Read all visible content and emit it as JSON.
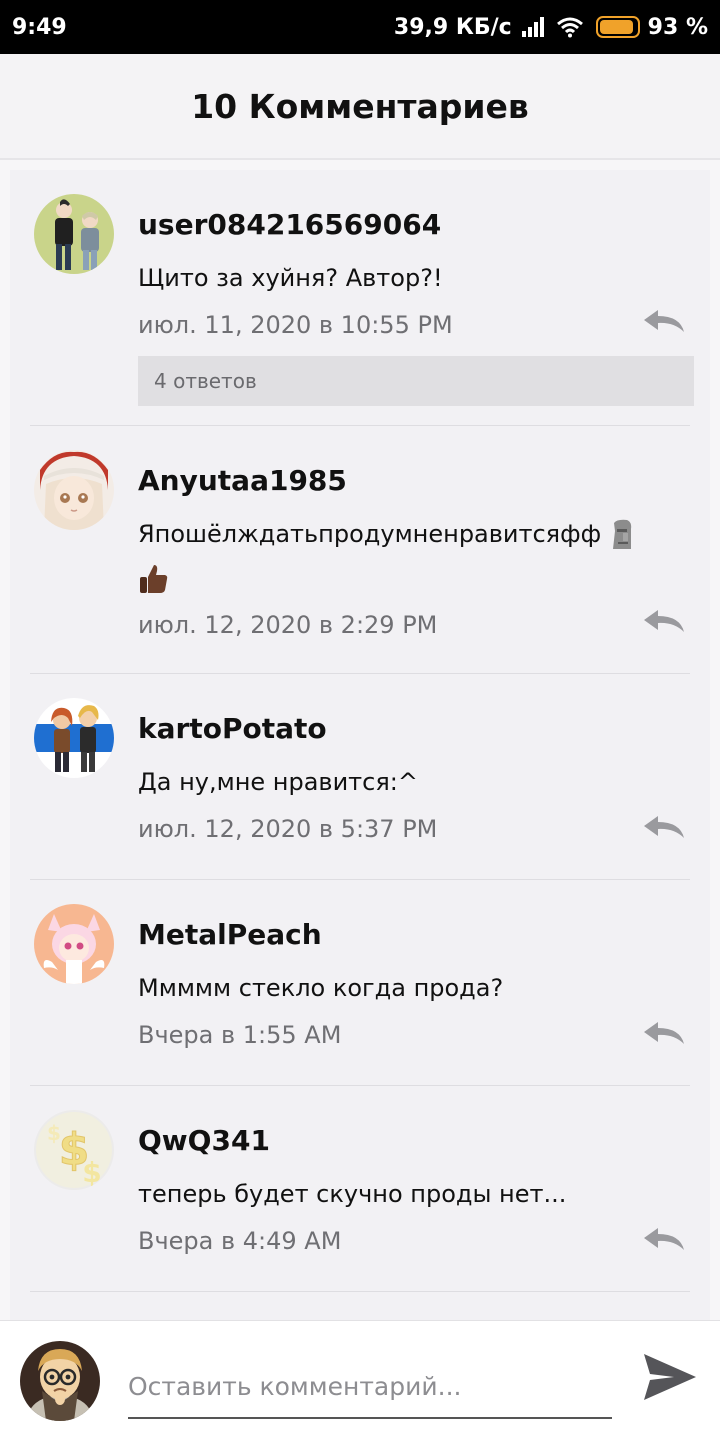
{
  "status_bar": {
    "time": "9:49",
    "network_speed": "39,9 КБ/с",
    "battery_percent": "93 %",
    "battery_level": 0.93,
    "battery_color": "#f0a22a",
    "icons": [
      "signal-icon",
      "wifi-icon",
      "battery-icon"
    ]
  },
  "header": {
    "title": "10 Комментариев"
  },
  "comments": [
    {
      "username": "user084216569064",
      "text": "Щито за хуйня? Автор?!",
      "date": "июл. 11, 2020 в 10:55 PM",
      "replies_label": "4 ответов",
      "avatar_icon": "user-avatar-icon"
    },
    {
      "username": "Anyutaa1985",
      "text": "Япошёлждатьпродумненравитсяфф",
      "emojis": [
        "moai-emoji",
        "thumbs-up-emoji"
      ],
      "date": "июл. 12, 2020 в 2:29 PM",
      "avatar_icon": "user-avatar-icon"
    },
    {
      "username": "kartoPotato",
      "text": "Да ну,мне нравится:^",
      "date": "июл. 12, 2020 в 5:37 PM",
      "avatar_icon": "user-avatar-icon"
    },
    {
      "username": "MetalPeach",
      "text": "Ммммм стекло когда прода?",
      "date": "Вчера в 1:55 AM",
      "avatar_icon": "user-avatar-icon"
    },
    {
      "username": "QwQ341",
      "text": "теперь будет скучно проды нет...",
      "date": "Вчера в 4:49 AM",
      "avatar_icon": "user-avatar-icon"
    }
  ],
  "composer": {
    "placeholder": "Оставить комментарий...",
    "value": "",
    "send_icon": "send-icon"
  },
  "colors": {
    "background": "#f2f1f4",
    "meta_text": "#6f6f73",
    "reply_icon": "#9a9a9e"
  }
}
